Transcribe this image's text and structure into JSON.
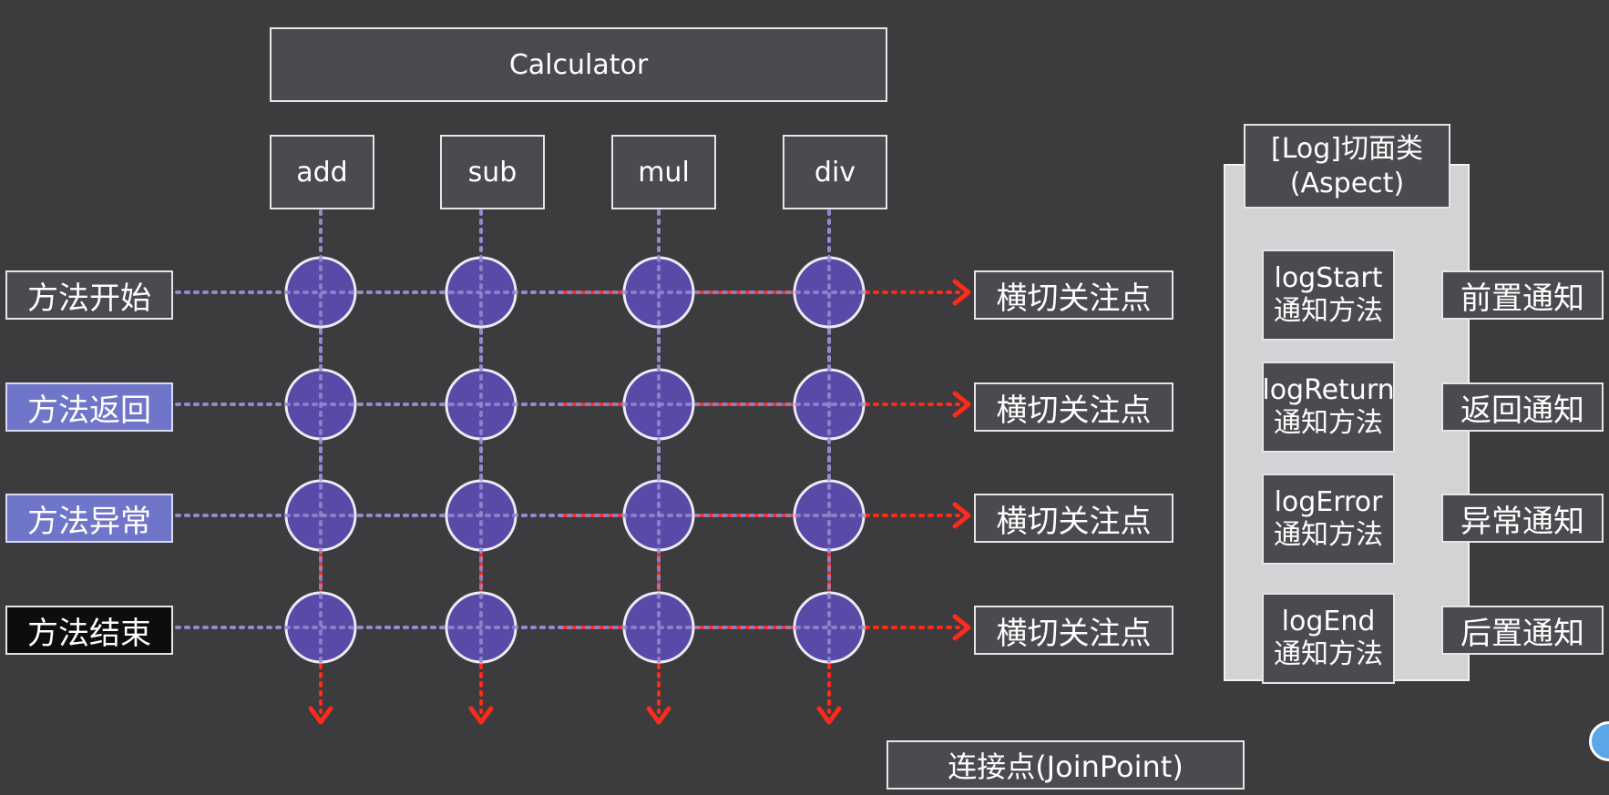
{
  "title": "Calculator",
  "methods": [
    "add",
    "sub",
    "mul",
    "div"
  ],
  "rows": [
    "方法开始",
    "方法返回",
    "方法异常",
    "方法结束"
  ],
  "concern_label": "横切关注点",
  "aspect": {
    "title_line1": "[Log]切面类",
    "title_line2": "(Aspect)",
    "advice": [
      {
        "method": "logStart",
        "sub": "通知方法",
        "type": "前置通知"
      },
      {
        "method": "logReturn",
        "sub": "通知方法",
        "type": "返回通知"
      },
      {
        "method": "logError",
        "sub": "通知方法",
        "type": "异常通知"
      },
      {
        "method": "logEnd",
        "sub": "通知方法",
        "type": "后置通知"
      }
    ]
  },
  "joinpoint_label": "连接点(JoinPoint)",
  "colors": {
    "background": "#3c3b3d",
    "node_fill": "#5a4aa8",
    "dotted_line": "#9a86d0",
    "arrow": "#ff2a1a",
    "highlight": "#6f75c8"
  }
}
